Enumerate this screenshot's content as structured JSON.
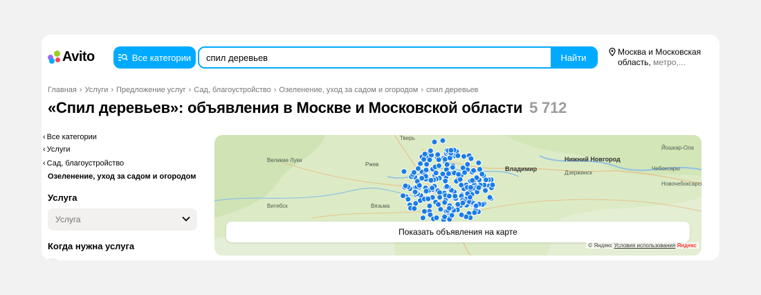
{
  "header": {
    "logo_text": "Avito",
    "categories_button": "Все категории",
    "search_value": "спил деревьев",
    "search_button": "Найти",
    "location_main": "Москва и Московская область,",
    "location_extra": "метро,..."
  },
  "breadcrumb": [
    "Главная",
    "Услуги",
    "Предложение услуг",
    "Сад, благоустройство",
    "Озеленение, уход за садом и огородом",
    "спил деревьев"
  ],
  "title": {
    "text": "«Спил деревьев»: объявления в Москве и Московской области",
    "count": "5 712"
  },
  "sidebar": {
    "links": [
      "Все категории",
      "Услуги",
      "Сад, благоустройство"
    ],
    "current": "Озеленение, уход за садом и огородом",
    "service_heading": "Услуга",
    "service_select": "Услуга",
    "when_heading": "Когда нужна услуга"
  },
  "map": {
    "show_button": "Показать объявления на карте",
    "attribution": "© Яндекс",
    "terms": "Условия использования",
    "yandex": "Яндекс",
    "cities": [
      "Тверь",
      "Великие Луки",
      "Ржев",
      "Владимир",
      "Нижний Новгород",
      "Йошкар-Ола",
      "Чебоксары",
      "Дзержинск",
      "Витебск",
      "Вязьма",
      "Новочебоксарск"
    ],
    "accent_color": "#1a7ce8"
  },
  "colors": {
    "brand": "#00aaff",
    "background": "#f2f2f2"
  }
}
